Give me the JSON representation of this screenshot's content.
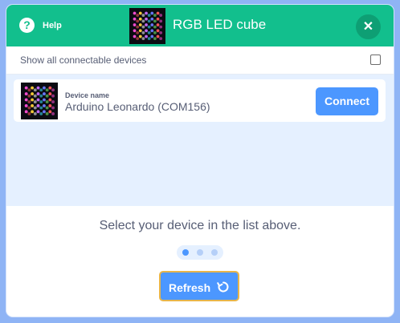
{
  "header": {
    "help_label": "Help",
    "help_icon": "question-icon",
    "title": "RGB LED cube",
    "close_icon": "close-icon",
    "colors": {
      "background": "#12bf8d",
      "close": "#0e9f74"
    }
  },
  "show_all": {
    "label": "Show all connectable devices",
    "checked": false
  },
  "devices": [
    {
      "name_label": "Device name",
      "name": "Arduino Leonardo (COM156)",
      "connect_label": "Connect"
    }
  ],
  "footer": {
    "instruction": "Select your device in the list above.",
    "step_active": 1,
    "step_count": 3,
    "refresh_label": "Refresh",
    "refresh_icon": "refresh-icon"
  },
  "colors": {
    "accent": "#4c97ff",
    "list_bg": "#e5f0ff",
    "text": "#575e75"
  }
}
